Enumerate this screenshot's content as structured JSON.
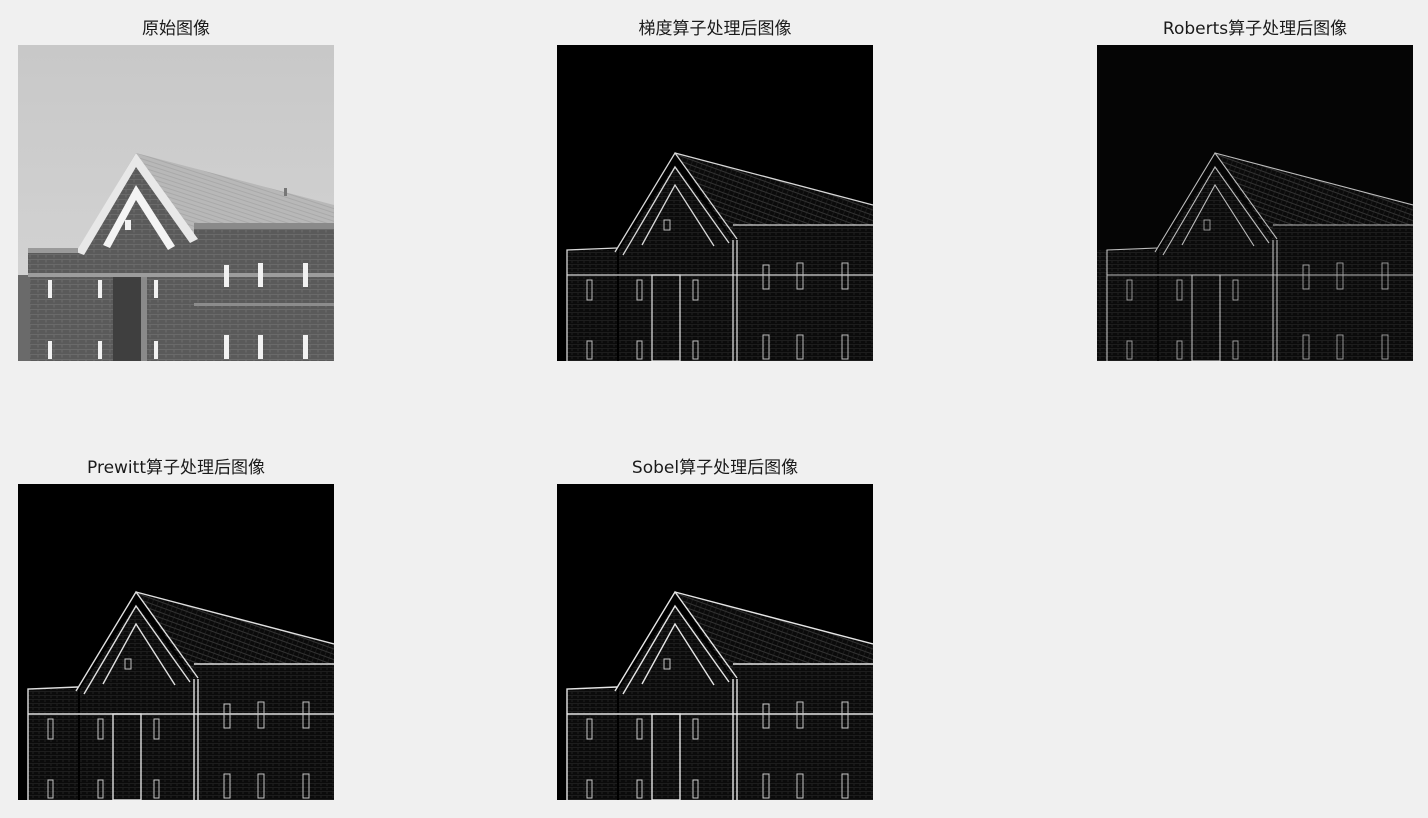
{
  "figure": {
    "panels": [
      {
        "title": "原始图像"
      },
      {
        "title": "梯度算子处理后图像"
      },
      {
        "title": "Roberts算子处理后图像"
      },
      {
        "title": "Prewitt算子处理后图像"
      },
      {
        "title": "Sobel算子处理后图像"
      }
    ]
  }
}
